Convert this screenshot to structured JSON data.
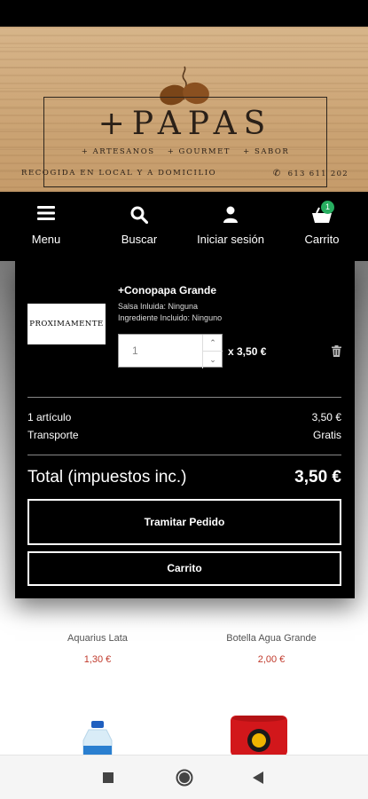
{
  "banner": {
    "logo_title": "+PAPAS",
    "logo_tags": [
      "+ ARTESANOS",
      "+ GOURMET",
      "+ SABOR"
    ],
    "tagline": "RECOGIDA EN LOCAL Y A DOMICILIO",
    "phone": "613 611 202"
  },
  "navbar": {
    "menu_label": "Menu",
    "search_label": "Buscar",
    "login_label": "Iniciar sesión",
    "cart_label": "Carrito",
    "cart_count": "1"
  },
  "cart_popup": {
    "item": {
      "thumb_text": "PROXIMAMENTE",
      "name": "+Conopapa Grande",
      "attr1": "Salsa Inluida: Ninguna",
      "attr2": "Ingrediente Incluido: Ninguno",
      "quantity": "1",
      "unit_price": "x 3,50 €"
    },
    "summary": {
      "articles_label": "1 artículo",
      "articles_value": "3,50 €",
      "shipping_label": "Transporte",
      "shipping_value": "Gratis"
    },
    "total_label": "Total (impuestos inc.)",
    "total_value": "3,50 €",
    "checkout_button": "Tramitar Pedido",
    "cart_button": "Carrito"
  },
  "products": [
    {
      "name": "Aquarius Lata",
      "price": "1,30 €"
    },
    {
      "name": "Botella Agua Grande",
      "price": "2,00 €"
    }
  ],
  "colors": {
    "accent_green": "#27ae60",
    "price_red": "#c0392b",
    "navbar_bg": "#000000"
  }
}
